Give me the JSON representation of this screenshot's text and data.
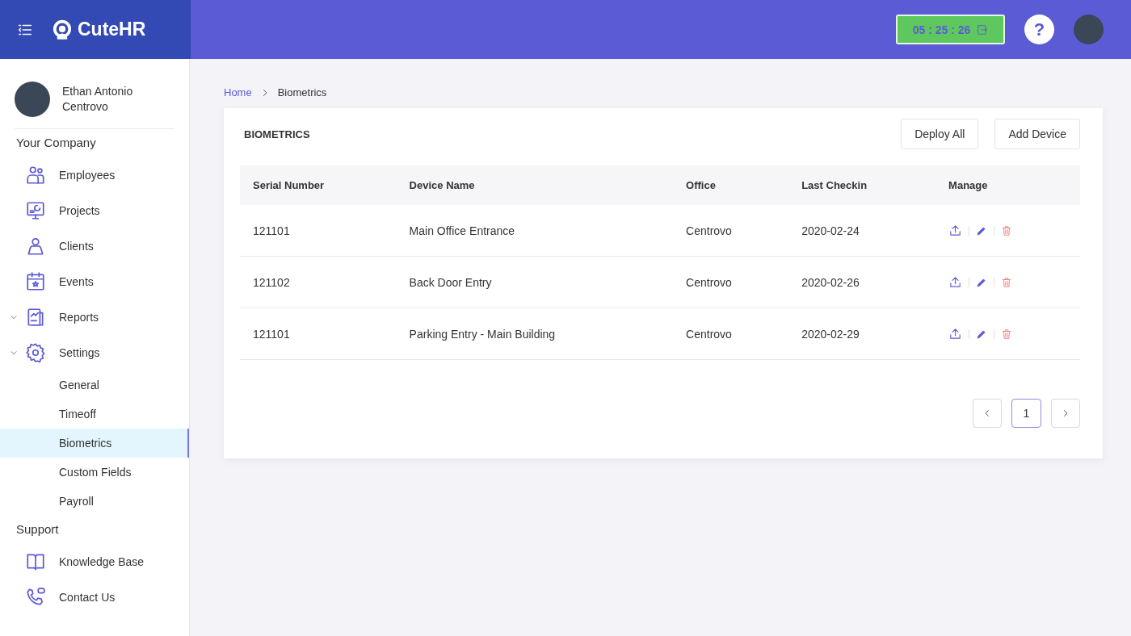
{
  "brand": {
    "name": "CuteHR"
  },
  "topbar": {
    "timer": "05 : 25 : 26",
    "help": "?"
  },
  "user": {
    "name": "Ethan Antonio Centrovo"
  },
  "sidebar": {
    "sections": [
      {
        "title": "Your Company",
        "items": [
          {
            "label": "Employees"
          },
          {
            "label": "Projects"
          },
          {
            "label": "Clients"
          },
          {
            "label": "Events"
          },
          {
            "label": "Reports",
            "expanded": true
          },
          {
            "label": "Settings",
            "expanded": true,
            "children": [
              {
                "label": "General",
                "selected": false
              },
              {
                "label": "Timeoff",
                "selected": false
              },
              {
                "label": "Biometrics",
                "selected": true
              },
              {
                "label": "Custom Fields",
                "selected": false
              },
              {
                "label": "Payroll",
                "selected": false
              }
            ]
          }
        ]
      },
      {
        "title": "Support",
        "items": [
          {
            "label": "Knowledge Base"
          },
          {
            "label": "Contact Us"
          }
        ]
      }
    ]
  },
  "breadcrumb": [
    "Home",
    "Biometrics"
  ],
  "card": {
    "title": "BIOMETRICS",
    "buttons": [
      "Deploy All",
      "Add Device"
    ]
  },
  "table": {
    "columns": [
      "Serial Number",
      "Device Name",
      "Office",
      "Last Checkin",
      "Manage"
    ],
    "rows": [
      [
        "121101",
        "Main Office Entrance",
        "Centrovo",
        "2020-02-24"
      ],
      [
        "121102",
        "Back Door Entry",
        "Centrovo",
        "2020-02-26"
      ],
      [
        "121101",
        "Parking Entry - Main Building",
        "Centrovo",
        "2020-02-29"
      ]
    ]
  },
  "pagination": {
    "pages": [
      {
        "label": "1",
        "selected": true
      }
    ]
  }
}
